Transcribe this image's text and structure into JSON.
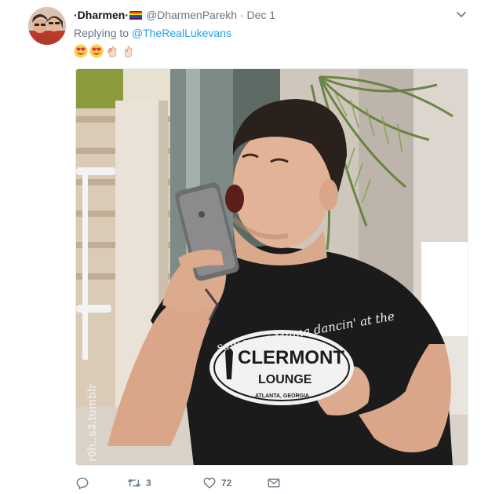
{
  "tweet": {
    "author": {
      "display_name": "·Dharmen·",
      "handle": "@DharmenParekh",
      "separator": "·",
      "date": "Dec 1"
    },
    "replying_prefix": "Replying to ",
    "replying_to": "@TheRealLukevans",
    "emojis": [
      "heart-eyes",
      "heart-eyes",
      "ok-hand",
      "ok-hand"
    ],
    "media": {
      "shirt_text_script": "saw your Mama dancin' at the",
      "shirt_text_title": "CLERMONT",
      "shirt_text_sub": "LOUNGE",
      "shirt_text_city": "ATLANTA, GEORGIA",
      "watermark": "r0h..s3.tumblr"
    },
    "actions": {
      "reply_count": "",
      "retweet_count": "3",
      "like_count": "72"
    }
  },
  "colors": {
    "link": "#1da1f2",
    "muted": "#657786",
    "text": "#14171a"
  },
  "icons": {
    "caret": "chevron-down-icon",
    "reply": "reply-icon",
    "retweet": "retweet-icon",
    "like": "heart-icon",
    "dm": "envelope-icon"
  }
}
